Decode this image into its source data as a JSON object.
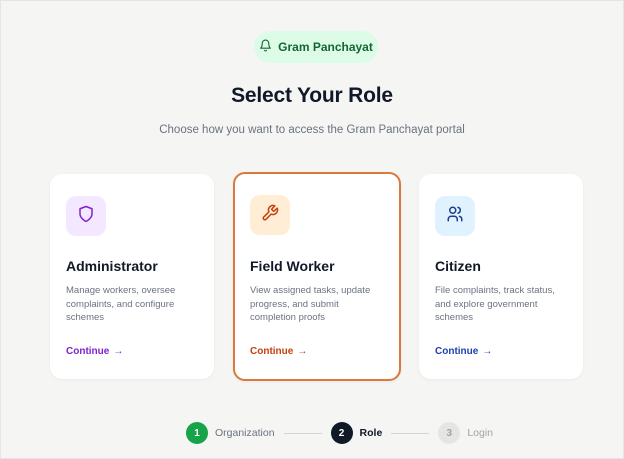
{
  "header": {
    "badge_label": "Gram Panchayat",
    "badge_icon": "bell-icon",
    "title": "Select Your Role",
    "subtitle": "Choose how you want to access the Gram Panchayat portal"
  },
  "roles": [
    {
      "title": "Administrator",
      "description": "Manage workers, oversee complaints, and configure schemes",
      "link_label": "Continue",
      "icon": "shield-icon",
      "accent": "#7e22ce",
      "icon_bg": "#f3e8ff",
      "selected": false
    },
    {
      "title": "Field Worker",
      "description": "View assigned tasks, update progress, and submit completion proofs",
      "link_label": "Continue",
      "icon": "wrench-icon",
      "accent": "#c2410c",
      "icon_bg": "#ffedd5",
      "selected": true
    },
    {
      "title": "Citizen",
      "description": "File complaints, track status, and explore government schemes",
      "link_label": "Continue",
      "icon": "users-icon",
      "accent": "#1e40af",
      "icon_bg": "#e0f2fe",
      "selected": false
    }
  ],
  "stepper": {
    "steps": [
      {
        "number": "1",
        "label": "Organization",
        "state": "done",
        "color": "#16a34a"
      },
      {
        "number": "2",
        "label": "Role",
        "state": "current",
        "color": "#111827"
      },
      {
        "number": "3",
        "label": "Login",
        "state": "upcoming",
        "color": "#e7e5e4"
      }
    ]
  },
  "colors": {
    "background": "#f5f5f4",
    "badge_bg": "#dcfce7",
    "badge_text": "#166534",
    "selected_border": "#d97a3a"
  }
}
